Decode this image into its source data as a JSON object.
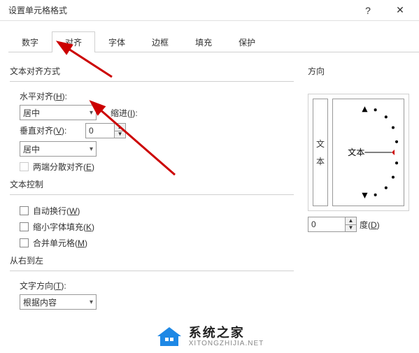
{
  "window": {
    "title": "设置单元格格式",
    "help": "?",
    "close": "✕"
  },
  "tabs": [
    "数字",
    "对齐",
    "字体",
    "边框",
    "填充",
    "保护"
  ],
  "active_tab": 1,
  "align": {
    "section": "文本对齐方式",
    "h_label_pre": "水平对齐(",
    "h_key": "H",
    "h_label_post": "):",
    "h_value": "居中",
    "indent_label_pre": "缩进(",
    "indent_key": "I",
    "indent_label_post": "):",
    "indent_value": "0",
    "v_label_pre": "垂直对齐(",
    "v_key": "V",
    "v_label_post": "):",
    "v_value": "居中",
    "justify_pre": "两端分散对齐(",
    "justify_key": "E",
    "justify_post": ")"
  },
  "textctrl": {
    "section": "文本控制",
    "wrap_pre": "自动换行(",
    "wrap_key": "W",
    "wrap_post": ")",
    "shrink_pre": "缩小字体填充(",
    "shrink_key": "K",
    "shrink_post": ")",
    "merge_pre": "合并单元格(",
    "merge_key": "M",
    "merge_post": ")"
  },
  "rtl": {
    "section": "从右到左",
    "dir_pre": "文字方向(",
    "dir_key": "T",
    "dir_post": "):",
    "dir_value": "根据内容"
  },
  "orient": {
    "section": "方向",
    "vtext1": "文",
    "vtext2": "本",
    "htext": "文本",
    "deg_value": "0",
    "deg_pre": "度(",
    "deg_key": "D",
    "deg_post": ")"
  },
  "watermark": {
    "line1": "系统之家",
    "line2": "XITONGZHIJIA.NET"
  }
}
